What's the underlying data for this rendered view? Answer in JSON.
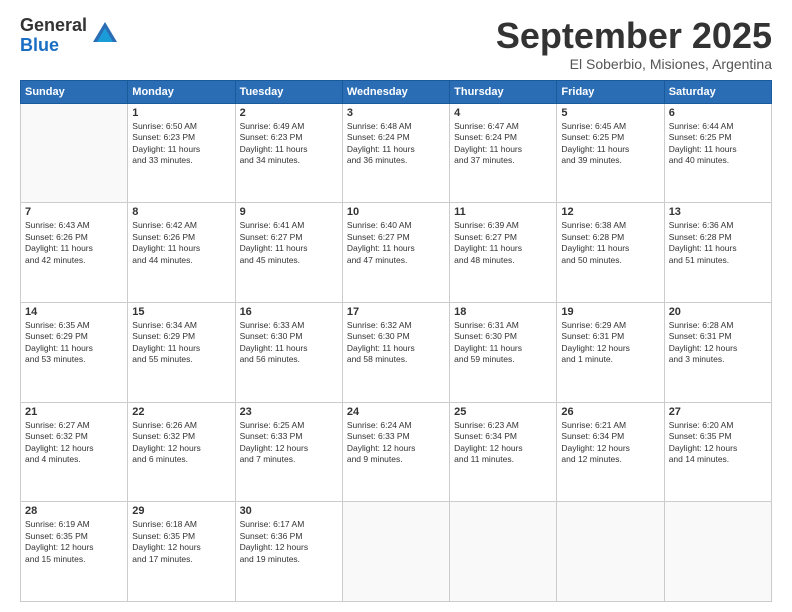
{
  "logo": {
    "general": "General",
    "blue": "Blue"
  },
  "title": "September 2025",
  "subtitle": "El Soberbio, Misiones, Argentina",
  "days_header": [
    "Sunday",
    "Monday",
    "Tuesday",
    "Wednesday",
    "Thursday",
    "Friday",
    "Saturday"
  ],
  "weeks": [
    [
      {
        "num": "",
        "info": ""
      },
      {
        "num": "1",
        "info": "Sunrise: 6:50 AM\nSunset: 6:23 PM\nDaylight: 11 hours\nand 33 minutes."
      },
      {
        "num": "2",
        "info": "Sunrise: 6:49 AM\nSunset: 6:23 PM\nDaylight: 11 hours\nand 34 minutes."
      },
      {
        "num": "3",
        "info": "Sunrise: 6:48 AM\nSunset: 6:24 PM\nDaylight: 11 hours\nand 36 minutes."
      },
      {
        "num": "4",
        "info": "Sunrise: 6:47 AM\nSunset: 6:24 PM\nDaylight: 11 hours\nand 37 minutes."
      },
      {
        "num": "5",
        "info": "Sunrise: 6:45 AM\nSunset: 6:25 PM\nDaylight: 11 hours\nand 39 minutes."
      },
      {
        "num": "6",
        "info": "Sunrise: 6:44 AM\nSunset: 6:25 PM\nDaylight: 11 hours\nand 40 minutes."
      }
    ],
    [
      {
        "num": "7",
        "info": "Sunrise: 6:43 AM\nSunset: 6:26 PM\nDaylight: 11 hours\nand 42 minutes."
      },
      {
        "num": "8",
        "info": "Sunrise: 6:42 AM\nSunset: 6:26 PM\nDaylight: 11 hours\nand 44 minutes."
      },
      {
        "num": "9",
        "info": "Sunrise: 6:41 AM\nSunset: 6:27 PM\nDaylight: 11 hours\nand 45 minutes."
      },
      {
        "num": "10",
        "info": "Sunrise: 6:40 AM\nSunset: 6:27 PM\nDaylight: 11 hours\nand 47 minutes."
      },
      {
        "num": "11",
        "info": "Sunrise: 6:39 AM\nSunset: 6:27 PM\nDaylight: 11 hours\nand 48 minutes."
      },
      {
        "num": "12",
        "info": "Sunrise: 6:38 AM\nSunset: 6:28 PM\nDaylight: 11 hours\nand 50 minutes."
      },
      {
        "num": "13",
        "info": "Sunrise: 6:36 AM\nSunset: 6:28 PM\nDaylight: 11 hours\nand 51 minutes."
      }
    ],
    [
      {
        "num": "14",
        "info": "Sunrise: 6:35 AM\nSunset: 6:29 PM\nDaylight: 11 hours\nand 53 minutes."
      },
      {
        "num": "15",
        "info": "Sunrise: 6:34 AM\nSunset: 6:29 PM\nDaylight: 11 hours\nand 55 minutes."
      },
      {
        "num": "16",
        "info": "Sunrise: 6:33 AM\nSunset: 6:30 PM\nDaylight: 11 hours\nand 56 minutes."
      },
      {
        "num": "17",
        "info": "Sunrise: 6:32 AM\nSunset: 6:30 PM\nDaylight: 11 hours\nand 58 minutes."
      },
      {
        "num": "18",
        "info": "Sunrise: 6:31 AM\nSunset: 6:30 PM\nDaylight: 11 hours\nand 59 minutes."
      },
      {
        "num": "19",
        "info": "Sunrise: 6:29 AM\nSunset: 6:31 PM\nDaylight: 12 hours\nand 1 minute."
      },
      {
        "num": "20",
        "info": "Sunrise: 6:28 AM\nSunset: 6:31 PM\nDaylight: 12 hours\nand 3 minutes."
      }
    ],
    [
      {
        "num": "21",
        "info": "Sunrise: 6:27 AM\nSunset: 6:32 PM\nDaylight: 12 hours\nand 4 minutes."
      },
      {
        "num": "22",
        "info": "Sunrise: 6:26 AM\nSunset: 6:32 PM\nDaylight: 12 hours\nand 6 minutes."
      },
      {
        "num": "23",
        "info": "Sunrise: 6:25 AM\nSunset: 6:33 PM\nDaylight: 12 hours\nand 7 minutes."
      },
      {
        "num": "24",
        "info": "Sunrise: 6:24 AM\nSunset: 6:33 PM\nDaylight: 12 hours\nand 9 minutes."
      },
      {
        "num": "25",
        "info": "Sunrise: 6:23 AM\nSunset: 6:34 PM\nDaylight: 12 hours\nand 11 minutes."
      },
      {
        "num": "26",
        "info": "Sunrise: 6:21 AM\nSunset: 6:34 PM\nDaylight: 12 hours\nand 12 minutes."
      },
      {
        "num": "27",
        "info": "Sunrise: 6:20 AM\nSunset: 6:35 PM\nDaylight: 12 hours\nand 14 minutes."
      }
    ],
    [
      {
        "num": "28",
        "info": "Sunrise: 6:19 AM\nSunset: 6:35 PM\nDaylight: 12 hours\nand 15 minutes."
      },
      {
        "num": "29",
        "info": "Sunrise: 6:18 AM\nSunset: 6:35 PM\nDaylight: 12 hours\nand 17 minutes."
      },
      {
        "num": "30",
        "info": "Sunrise: 6:17 AM\nSunset: 6:36 PM\nDaylight: 12 hours\nand 19 minutes."
      },
      {
        "num": "",
        "info": ""
      },
      {
        "num": "",
        "info": ""
      },
      {
        "num": "",
        "info": ""
      },
      {
        "num": "",
        "info": ""
      }
    ]
  ]
}
